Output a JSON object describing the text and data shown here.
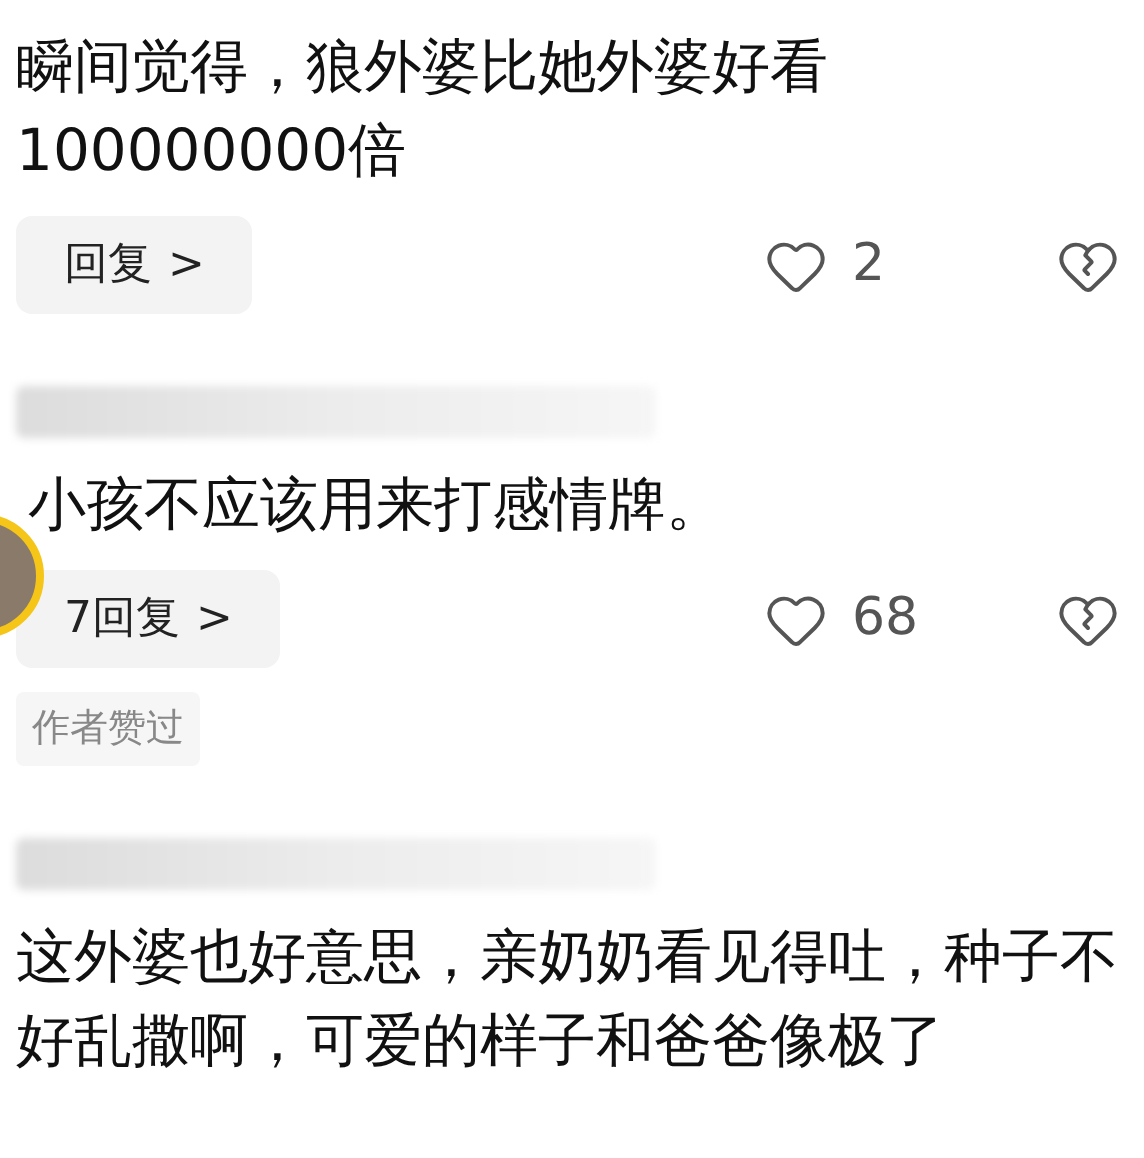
{
  "comments": [
    {
      "has_avatar": false,
      "show_username": false,
      "text": "瞬间觉得，狼外婆比她外婆好看100000000倍",
      "actions": {
        "reply": "回复",
        "chevron": ">",
        "likes": "2"
      }
    },
    {
      "has_avatar": true,
      "show_username": true,
      "text": "小孩不应该用来打感情牌。",
      "actions": {
        "reply": "7回复",
        "chevron": ">",
        "likes": "68"
      },
      "badge": "作者赞过"
    },
    {
      "has_avatar": false,
      "show_username": true,
      "text": "这外婆也好意思，亲奶奶看见得吐，种子不好乱撒啊，可爱的样子和爸爸像极了"
    }
  ]
}
